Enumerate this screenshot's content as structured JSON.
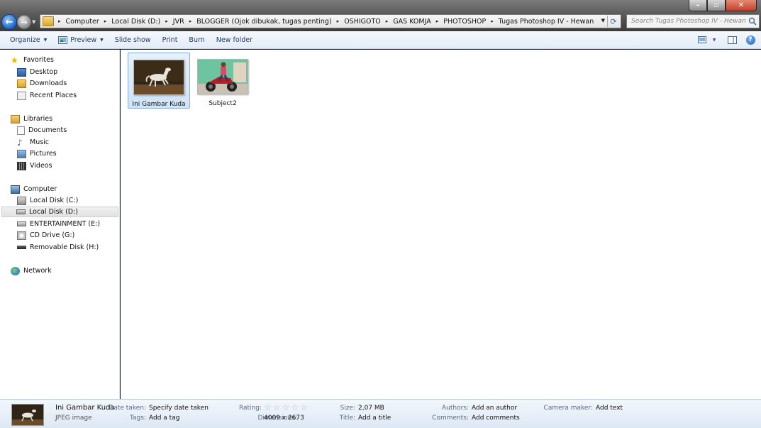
{
  "window": {
    "controls": {
      "minimize": "–",
      "maximize": "▫",
      "close": "✕"
    }
  },
  "address": {
    "crumbs": [
      "Computer",
      "Local Disk (D:)",
      "JVR",
      "BLOGGER (Ojok dibukak, tugas penting)",
      "OSHIGOTO",
      "GAS KOMJA",
      "PHOTOSHOP",
      "Tugas Photoshop IV - Hewan"
    ]
  },
  "search": {
    "placeholder": "Search Tugas Photoshop IV - Hewan"
  },
  "toolbar": {
    "organize": "Organize",
    "preview": "Preview",
    "slideshow": "Slide show",
    "print": "Print",
    "burn": "Burn",
    "new_folder": "New folder"
  },
  "nav": {
    "favorites": "Favorites",
    "desktop": "Desktop",
    "downloads": "Downloads",
    "recent": "Recent Places",
    "libraries": "Libraries",
    "documents": "Documents",
    "music": "Music",
    "pictures": "Pictures",
    "videos": "Videos",
    "computer": "Computer",
    "disk_c": "Local Disk (C:)",
    "disk_d": "Local Disk (D:)",
    "disk_e": "ENTERTAINMENT (E:)",
    "cd_g": "CD Drive (G:)",
    "removable_h": "Removable Disk (H:)",
    "network": "Network"
  },
  "files": [
    {
      "name": "Ini Gambar Kuda",
      "selected": true
    },
    {
      "name": "Subject2",
      "selected": false
    }
  ],
  "details": {
    "name": "Ini Gambar Kuda",
    "type": "JPEG image",
    "date_taken_label": "Date taken:",
    "date_taken_value": "Specify date taken",
    "tags_label": "Tags:",
    "tags_value": "Add a tag",
    "rating_label": "Rating:",
    "rating_value": 0,
    "dimensions_label": "Dimensions:",
    "dimensions_value": "4009 x 2673",
    "size_label": "Size:",
    "size_value": "2,07 MB",
    "title_label": "Title:",
    "title_value": "Add a title",
    "authors_label": "Authors:",
    "authors_value": "Add an author",
    "comments_label": "Comments:",
    "comments_value": "Add comments",
    "camera_label": "Camera maker:",
    "camera_value": "Add text"
  }
}
